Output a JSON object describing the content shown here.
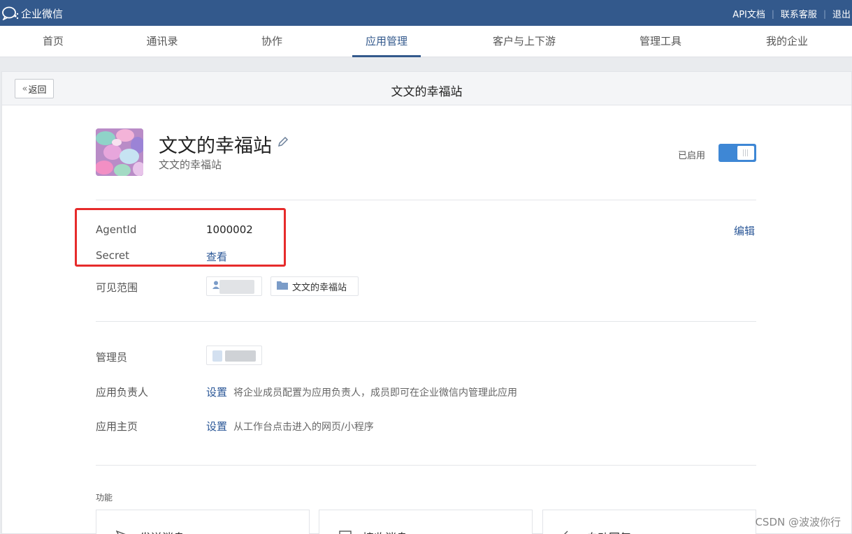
{
  "topbar": {
    "brand": "企业微信",
    "links": [
      "API文档",
      "联系客服",
      "退出"
    ]
  },
  "nav": {
    "items": [
      "首页",
      "通讯录",
      "协作",
      "应用管理",
      "客户与上下游",
      "管理工具",
      "我的企业"
    ],
    "active_index": 3
  },
  "page": {
    "back_label": "返回",
    "title": "文文的幸福站"
  },
  "app": {
    "name": "文文的幸福站",
    "subtitle": "文文的幸福站",
    "status_label": "已启用",
    "enabled": true
  },
  "details": {
    "agentid_label": "AgentId",
    "agentid_value": "1000002",
    "secret_label": "Secret",
    "secret_link": "查看",
    "edit_link": "编辑",
    "visible_label": "可见范围",
    "visible_dept": "文文的幸福站",
    "admin_label": "管理员",
    "owner_label": "应用负责人",
    "owner_link": "设置",
    "owner_hint": "将企业成员配置为应用负责人，成员即可在企业微信内管理此应用",
    "homepage_label": "应用主页",
    "homepage_link": "设置",
    "homepage_hint": "从工作台点击进入的网页/小程序"
  },
  "features": {
    "section_label": "功能",
    "items": [
      "发送消息",
      "接收消息",
      "自动回复"
    ]
  },
  "watermark": "CSDN @波波你行",
  "colors": {
    "topbar": "#33598c",
    "link": "#2b5797",
    "toggle_on": "#3e87d5",
    "highlight": "#e62b2b"
  }
}
